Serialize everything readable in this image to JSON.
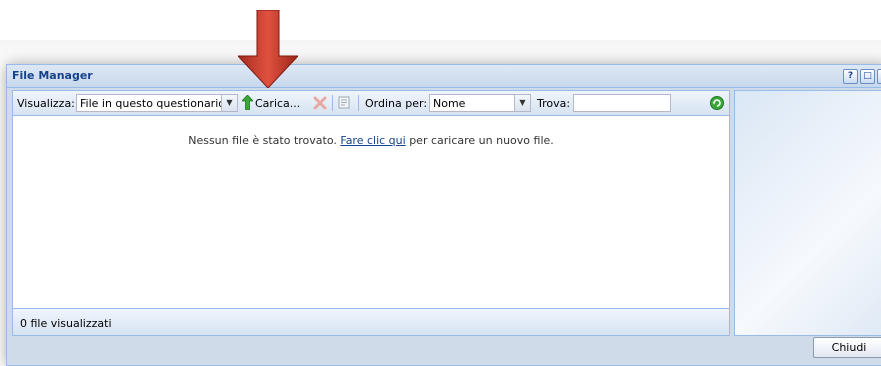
{
  "window": {
    "title": "File Manager",
    "tool_buttons": [
      "?",
      "□",
      "x"
    ]
  },
  "toolbar": {
    "view_label": "Visualizza:",
    "view_value": "File in questo questionario",
    "upload_label": "Carica...",
    "sort_label": "Ordina per:",
    "sort_value": "Nome",
    "find_label": "Trova:",
    "find_value": "",
    "icons": {
      "upload": "upload-arrow-icon",
      "delete": "delete-x-icon",
      "properties": "properties-icon",
      "refresh": "refresh-icon"
    }
  },
  "content": {
    "message_before": "Nessun file è stato trovato.",
    "message_link": "Fare clic qui",
    "message_after": "per caricare un nuovo file."
  },
  "status": {
    "text": "0 file visualizzati"
  },
  "footer": {
    "close_label": "Chiudi"
  },
  "annotation": {
    "arrow_color": "#c0392b"
  }
}
